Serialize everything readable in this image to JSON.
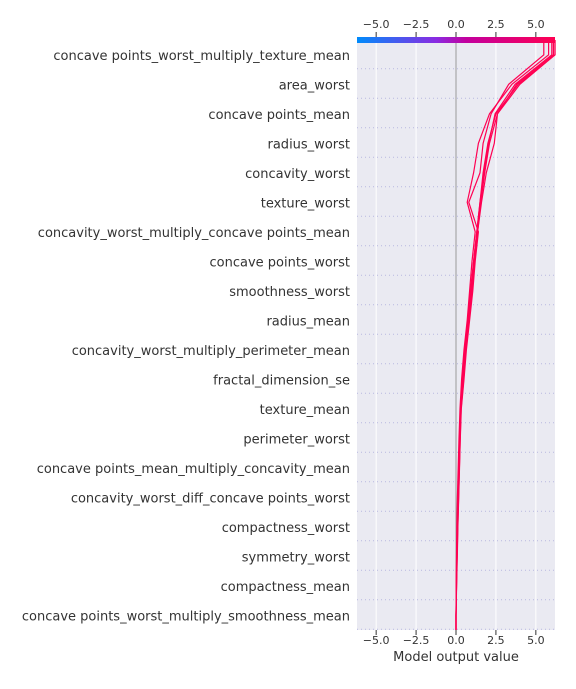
{
  "chart_data": {
    "type": "decision-plot",
    "title": "",
    "xlabel": "Model output value",
    "ylabel": "",
    "xlim": [
      -6.2,
      6.2
    ],
    "xticks": [
      -5.0,
      -2.5,
      0.0,
      2.5,
      5.0
    ],
    "xtick_labels": [
      "−5.0",
      "−2.5",
      "0.0",
      "2.5",
      "5.0"
    ],
    "base_value": 0.0,
    "grid": true,
    "legend": "none",
    "colormap": {
      "low": "#008bfb",
      "mid": "#8a2be2",
      "high": "#ff0052"
    },
    "features": [
      "concave points_worst_multiply_texture_mean",
      "area_worst",
      "concave points_mean",
      "radius_worst",
      "concavity_worst",
      "texture_worst",
      "concavity_worst_multiply_concave points_mean",
      "concave points_worst",
      "smoothness_worst",
      "radius_mean",
      "concavity_worst_multiply_perimeter_mean",
      "fractal_dimension_se",
      "texture_mean",
      "perimeter_worst",
      "concave points_mean_multiply_concavity_mean",
      "concavity_worst_diff_concave points_worst",
      "compactness_worst",
      "symmetry_worst",
      "compactness_mean",
      "concave points_worst_multiply_smoothness_mean"
    ],
    "series": [
      {
        "values": [
          0.0,
          0.03,
          0.06,
          0.1,
          0.15,
          0.2,
          0.25,
          0.3,
          0.45,
          0.6,
          0.8,
          1.0,
          1.15,
          1.35,
          1.6,
          1.9,
          2.4,
          2.6,
          3.8,
          6.1
        ]
      },
      {
        "values": [
          0.0,
          0.02,
          0.05,
          0.08,
          0.12,
          0.18,
          0.22,
          0.28,
          0.4,
          0.55,
          0.75,
          0.9,
          1.1,
          1.3,
          1.5,
          1.7,
          2.0,
          2.5,
          3.9,
          6.2
        ]
      },
      {
        "values": [
          0.0,
          0.04,
          0.08,
          0.12,
          0.17,
          0.22,
          0.27,
          0.33,
          0.5,
          0.65,
          0.85,
          1.05,
          1.2,
          1.4,
          0.8,
          1.5,
          1.7,
          2.2,
          3.3,
          5.5
        ]
      },
      {
        "values": [
          0.0,
          0.01,
          0.03,
          0.05,
          0.09,
          0.14,
          0.19,
          0.25,
          0.35,
          0.5,
          0.7,
          0.85,
          1.0,
          1.2,
          0.7,
          1.1,
          1.4,
          2.1,
          3.5,
          5.8
        ]
      },
      {
        "values": [
          0.0,
          0.03,
          0.07,
          0.11,
          0.16,
          0.21,
          0.26,
          0.32,
          0.48,
          0.62,
          0.82,
          0.98,
          1.15,
          1.35,
          1.55,
          1.8,
          2.1,
          2.6,
          4.0,
          6.2
        ]
      },
      {
        "values": [
          0.0,
          0.02,
          0.04,
          0.09,
          0.13,
          0.19,
          0.24,
          0.3,
          0.42,
          0.58,
          0.78,
          0.95,
          1.1,
          1.3,
          1.5,
          1.75,
          2.05,
          2.45,
          3.7,
          6.0
        ]
      }
    ]
  }
}
